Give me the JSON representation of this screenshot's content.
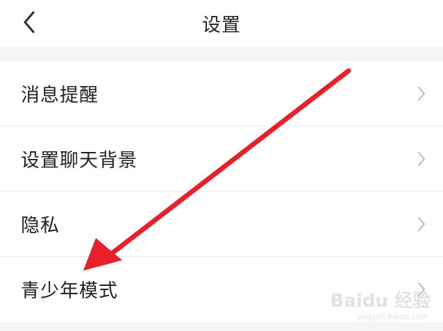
{
  "header": {
    "title": "设置"
  },
  "settings_items": [
    {
      "label": "消息提醒"
    },
    {
      "label": "设置聊天背景"
    },
    {
      "label": "隐私"
    },
    {
      "label": "青少年模式"
    }
  ],
  "watermark": {
    "brand": "Baidu 经验",
    "url": "jingyan.baidu.com"
  },
  "colors": {
    "annotation_arrow": "#e8202a",
    "background": "#f5f5f5",
    "row_background": "#ffffff"
  }
}
